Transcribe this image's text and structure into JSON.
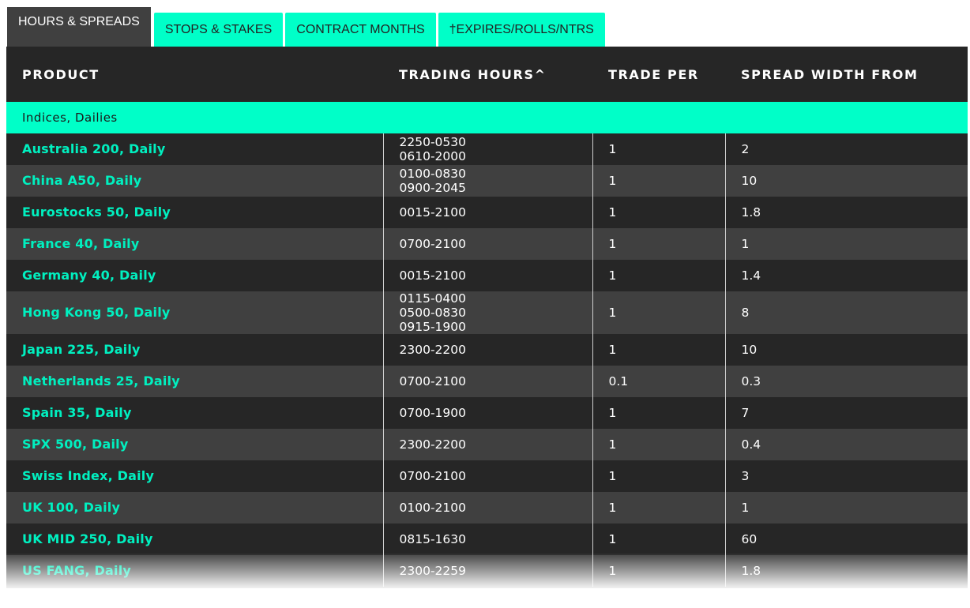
{
  "tabs": [
    {
      "label": "HOURS & SPREADS",
      "active": true
    },
    {
      "label": "STOPS & STAKES",
      "active": false
    },
    {
      "label": "CONTRACT MONTHS",
      "active": false
    },
    {
      "label": "†EXPIRES/ROLLS/NTRS",
      "active": false
    }
  ],
  "table": {
    "headers": {
      "product": "PRODUCT",
      "trading_hours": "TRADING HOURS^",
      "trade_per": "TRADE PER",
      "spread_width": "SPREAD WIDTH FROM"
    },
    "group_label": "Indices, Dailies",
    "rows": [
      {
        "product": "Australia 200, Daily",
        "hours": [
          "2250-0530",
          "0610-2000"
        ],
        "trade_per": "1",
        "spread": "2"
      },
      {
        "product": "China A50, Daily",
        "hours": [
          "0100-0830",
          "0900-2045"
        ],
        "trade_per": "1",
        "spread": "10"
      },
      {
        "product": "Eurostocks 50, Daily",
        "hours": [
          "0015-2100"
        ],
        "trade_per": "1",
        "spread": "1.8"
      },
      {
        "product": "France 40, Daily",
        "hours": [
          "0700-2100"
        ],
        "trade_per": "1",
        "spread": "1"
      },
      {
        "product": "Germany 40, Daily",
        "hours": [
          "0015-2100"
        ],
        "trade_per": "1",
        "spread": "1.4"
      },
      {
        "product": "Hong Kong 50, Daily",
        "hours": [
          "0115-0400",
          "0500-0830",
          "0915-1900"
        ],
        "trade_per": "1",
        "spread": "8"
      },
      {
        "product": "Japan 225, Daily",
        "hours": [
          "2300-2200"
        ],
        "trade_per": "1",
        "spread": "10"
      },
      {
        "product": "Netherlands 25, Daily",
        "hours": [
          "0700-2100"
        ],
        "trade_per": "0.1",
        "spread": "0.3"
      },
      {
        "product": "Spain 35, Daily",
        "hours": [
          "0700-1900"
        ],
        "trade_per": "1",
        "spread": "7"
      },
      {
        "product": "SPX 500, Daily",
        "hours": [
          "2300-2200"
        ],
        "trade_per": "1",
        "spread": "0.4"
      },
      {
        "product": "Swiss Index, Daily",
        "hours": [
          "0700-2100"
        ],
        "trade_per": "1",
        "spread": "3"
      },
      {
        "product": "UK 100, Daily",
        "hours": [
          "0100-2100"
        ],
        "trade_per": "1",
        "spread": "1"
      },
      {
        "product": "UK MID 250, Daily",
        "hours": [
          "0815-1630"
        ],
        "trade_per": "1",
        "spread": "60"
      },
      {
        "product": "US FANG, Daily",
        "hours": [
          "2300-2259"
        ],
        "trade_per": "1",
        "spread": "1.8"
      }
    ]
  },
  "colors": {
    "accent": "#00ffc8",
    "product_text": "#00f0c0",
    "header_bg": "#262626",
    "row_dark": "#262626",
    "row_light": "#404040",
    "active_tab_bg": "#404040"
  }
}
